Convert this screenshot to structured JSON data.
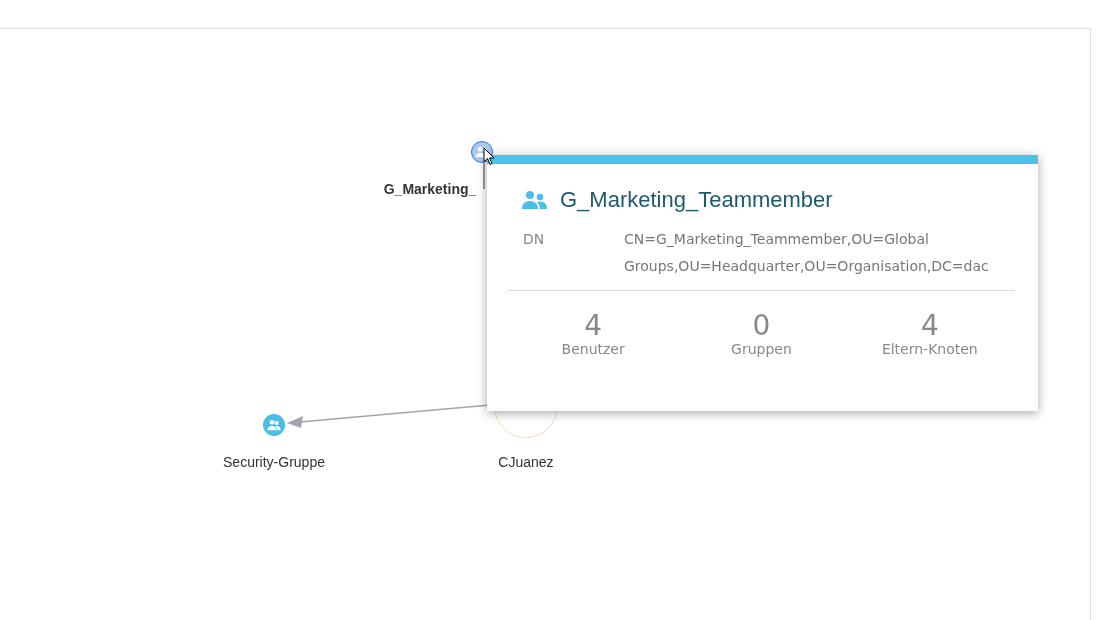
{
  "graph": {
    "nodes": [
      {
        "kind": "group",
        "label": "G_Marketing_",
        "selected": true
      },
      {
        "kind": "group",
        "label": "Security-Gruppe",
        "selected": false
      },
      {
        "kind": "user",
        "label": "CJuanez",
        "selected": false
      }
    ]
  },
  "tooltip": {
    "title": "G_Marketing_Teammember",
    "dn_label": "DN",
    "dn_value": "CN=G_Marketing_Teammember,OU=Global Groups,OU=Headquarter,OU=Organisation,DC=dac",
    "stats": [
      {
        "value": "4",
        "label": "Benutzer"
      },
      {
        "value": "0",
        "label": "Gruppen"
      },
      {
        "value": "4",
        "label": "Eltern-Knoten"
      }
    ]
  }
}
